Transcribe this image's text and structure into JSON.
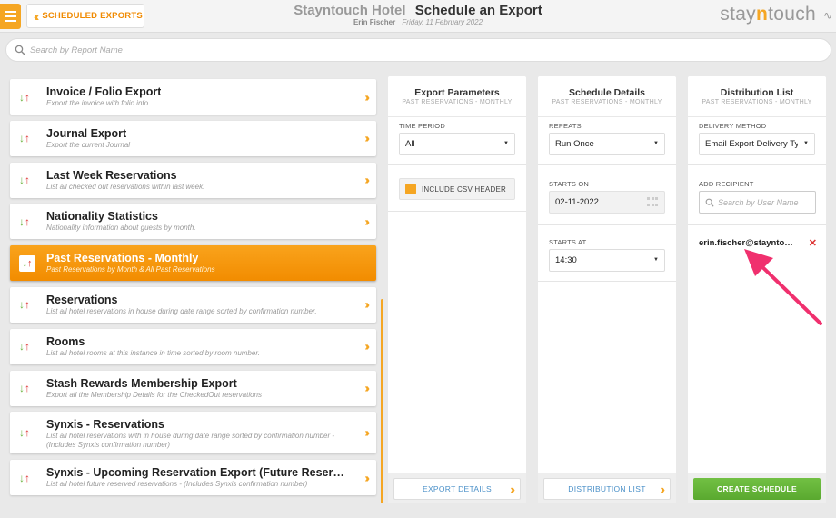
{
  "header": {
    "back_label": "SCHEDULED EXPORTS",
    "hotel_name": "Stayntouch Hotel",
    "page_title": "Schedule an Export",
    "user_name": "Erin Fischer",
    "date": "Friday, 11 February 2022",
    "logo_pre": "stay",
    "logo_n": "n",
    "logo_post": "touch"
  },
  "search": {
    "placeholder": "Search by Report Name"
  },
  "reports": [
    {
      "name": "Invoice / Folio Export",
      "desc": "Export the invoice with folio info"
    },
    {
      "name": "Journal Export",
      "desc": "Export the current Journal"
    },
    {
      "name": "Last Week Reservations",
      "desc": "List all checked out reservations within last week."
    },
    {
      "name": "Nationality Statistics",
      "desc": "Nationality information about guests by month."
    },
    {
      "name": "Past Reservations - Monthly",
      "desc": "Past Reservations by Month & All Past Reservations",
      "active": true
    },
    {
      "name": "Reservations",
      "desc": "List all hotel reservations in house during date range sorted by confirmation number."
    },
    {
      "name": "Rooms",
      "desc": "List all hotel rooms at this instance in time sorted by room number."
    },
    {
      "name": "Stash Rewards Membership Export",
      "desc": "Export all the Membership Details for the CheckedOut reservations"
    },
    {
      "name": "Synxis - Reservations",
      "desc": "List all hotel reservations with in house during date range sorted by confirmation number - (Includes Synxis confirmation number)"
    },
    {
      "name": "Synxis - Upcoming Reservation Export (Future Reservati...",
      "desc": "List all hotel future reserved reservations - (Includes Synxis confirmation number)"
    }
  ],
  "export_params": {
    "title": "Export Parameters",
    "subtitle": "PAST RESERVATIONS - MONTHLY",
    "time_period_label": "TIME PERIOD",
    "time_period_value": "All",
    "csv_header_label": "INCLUDE CSV HEADER",
    "footer_button": "EXPORT DETAILS"
  },
  "schedule": {
    "title": "Schedule Details",
    "subtitle": "PAST RESERVATIONS - MONTHLY",
    "repeats_label": "REPEATS",
    "repeats_value": "Run Once",
    "starts_on_label": "STARTS ON",
    "starts_on_value": "02-11-2022",
    "starts_at_label": "STARTS AT",
    "starts_at_value": "14:30",
    "footer_button": "DISTRIBUTION LIST"
  },
  "distribution": {
    "title": "Distribution List",
    "subtitle": "PAST RESERVATIONS - MONTHLY",
    "delivery_label": "DELIVERY METHOD",
    "delivery_value": "Email Export Delivery Type",
    "add_recipient_label": "ADD RECIPIENT",
    "recipient_placeholder": "Search by User Name",
    "recipient_email": "erin.fischer@stayntouch.com",
    "footer_button": "CREATE SCHEDULE"
  },
  "colors": {
    "accent": "#f5a623",
    "link": "#4a90c8",
    "success": "#5aa92f",
    "danger": "#dd3333"
  },
  "icons": {
    "menu": "hamburger-icon",
    "back": "double-chevron-left-icon",
    "search": "magnifier-icon",
    "report_sort": "down-up-arrows-icon",
    "go": "double-chevron-right-icon",
    "calendar": "calendar-grid-icon",
    "remove": "close-x-icon",
    "annotation": "pink-arrow-annotation"
  }
}
